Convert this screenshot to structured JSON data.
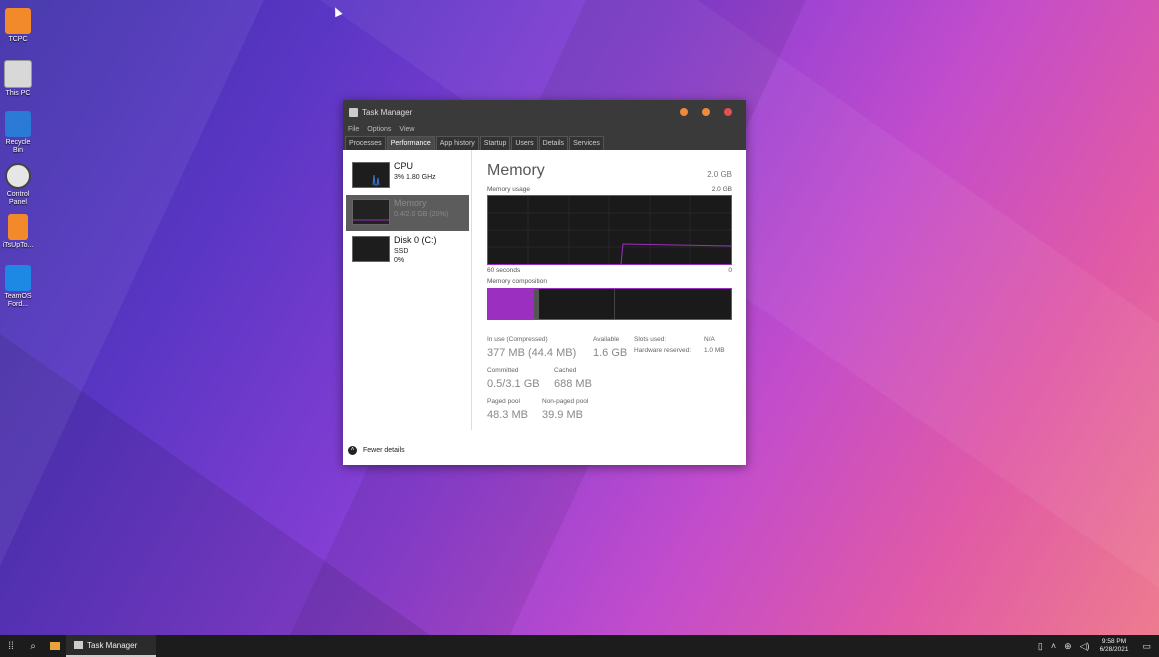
{
  "desktop": {
    "icons": [
      {
        "label": "TCPC",
        "color": "#f2892b"
      },
      {
        "label": "This PC",
        "color": "#d8d8d8"
      },
      {
        "label": "Recycle Bin",
        "color": "#2a7ad6"
      },
      {
        "label": "Control Panel",
        "color": "#e6e6e6"
      },
      {
        "label": "iTsUpTo...",
        "color": "#f2892b"
      },
      {
        "label": "TeamOS Ford...",
        "color": "#1e88e5"
      }
    ]
  },
  "window": {
    "title": "Task Manager",
    "menu": [
      "File",
      "Options",
      "View"
    ],
    "tabs": [
      "Processes",
      "Performance",
      "App history",
      "Startup",
      "Users",
      "Details",
      "Services"
    ],
    "active_tab": "Performance",
    "sidebar": [
      {
        "name": "CPU",
        "sub1": "3% 1.80 GHz"
      },
      {
        "name": "Memory",
        "sub1": "0.4/2.0 GB (20%)"
      },
      {
        "name": "Disk 0 (C:)",
        "sub1": "SSD",
        "sub2": "0%"
      }
    ],
    "memory": {
      "title": "Memory",
      "total": "2.0 GB",
      "usage_label": "Memory usage",
      "usage_max": "2.0 GB",
      "time_left": "60 seconds",
      "time_right": "0",
      "composition_label": "Memory composition",
      "stats": {
        "in_use_label": "In use (Compressed)",
        "in_use_value": "377 MB (44.4 MB)",
        "available_label": "Available",
        "available_value": "1.6 GB",
        "slots_label": "Slots used:",
        "slots_value": "N/A",
        "hw_label": "Hardware reserved:",
        "hw_value": "1.0 MB",
        "committed_label": "Committed",
        "committed_value": "0.5/3.1 GB",
        "cached_label": "Cached",
        "cached_value": "688 MB",
        "paged_label": "Paged pool",
        "paged_value": "48.3 MB",
        "nonpaged_label": "Non-paged pool",
        "nonpaged_value": "39.9 MB"
      }
    },
    "footer": "Fewer details"
  },
  "taskbar": {
    "app_label": "Task Manager",
    "time": "9:58 PM",
    "date": "6/28/2021"
  }
}
